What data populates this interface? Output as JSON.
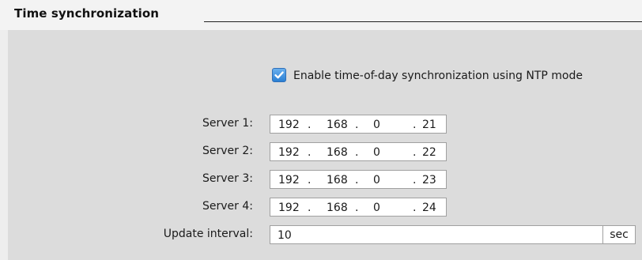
{
  "section": {
    "title": "Time synchronization"
  },
  "ntp": {
    "checkbox_label": "Enable time-of-day synchronization using NTP mode",
    "checked": true
  },
  "servers": [
    {
      "label": "Server 1:",
      "octets": [
        "192",
        "168",
        "0",
        "21"
      ]
    },
    {
      "label": "Server 2:",
      "octets": [
        "192",
        "168",
        "0",
        "22"
      ]
    },
    {
      "label": "Server 3:",
      "octets": [
        "192",
        "168",
        "0",
        "23"
      ]
    },
    {
      "label": "Server 4:",
      "octets": [
        "192",
        "168",
        "0",
        "24"
      ]
    }
  ],
  "interval": {
    "label": "Update interval:",
    "value": "10",
    "unit": "sec"
  },
  "separator": ".",
  "colors": {
    "checkbox_accent": "#2a7fd4",
    "panel_background": "#dcdcdc",
    "header_background": "#f3f3f3"
  }
}
